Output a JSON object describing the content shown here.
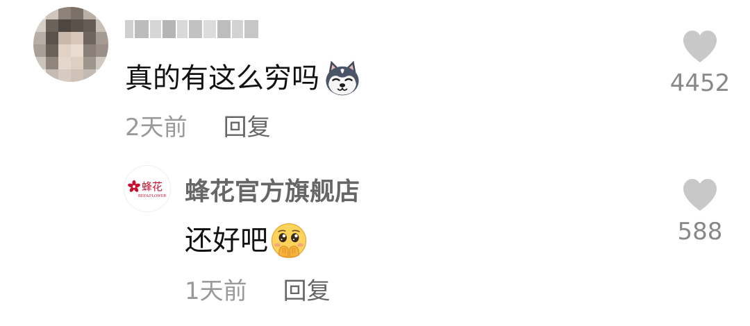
{
  "comment": {
    "text": "真的有这么穷吗",
    "emoji": "husky-dog-emoji",
    "time": "2天前",
    "reply_label": "回复",
    "like_count": "4452"
  },
  "reply": {
    "author": "蜂花官方旗舰店",
    "avatar_logo": {
      "brand_cn": "蜂花",
      "brand_en": "BEE&FLOWER"
    },
    "text": "还好吧",
    "emoji": "blushing-hands-over-mouth-emoji",
    "time": "1天前",
    "reply_label": "回复",
    "like_count": "588"
  },
  "colors": {
    "text_primary": "#111111",
    "text_meta": "#999999",
    "text_reply_button": "#666666",
    "heart": "#c8c8c8",
    "brand_red": "#c8102e"
  },
  "icons": [
    "heart-icon",
    "husky-dog-emoji",
    "blushing-hands-over-mouth-emoji"
  ]
}
